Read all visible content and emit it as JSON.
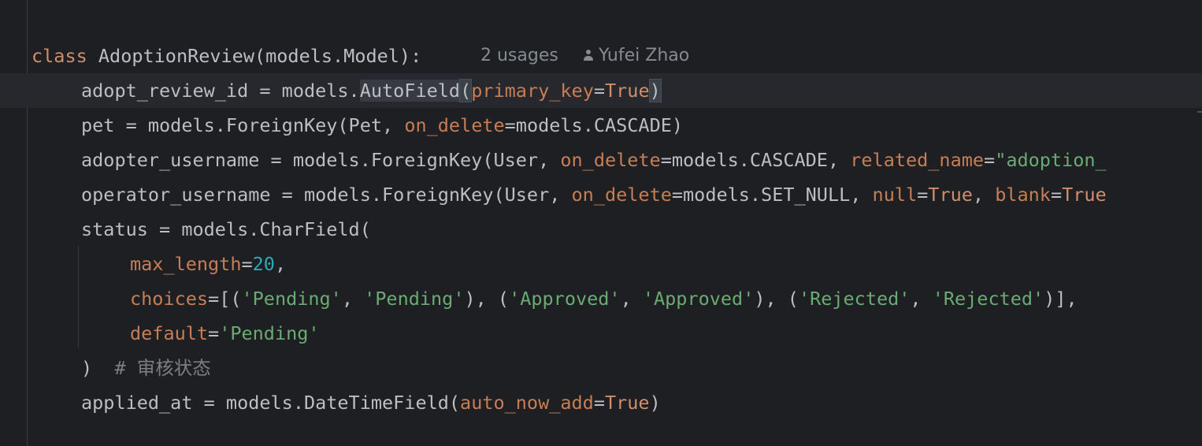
{
  "code": {
    "class_line": {
      "keyword": "class",
      "name": "AdoptionReview",
      "open": "(",
      "base": "models.Model",
      "close": "):",
      "usages": "2 usages",
      "author": "Yufei Zhao"
    },
    "line_id": {
      "a": "adopt_review_id = models.",
      "b": "AutoField",
      "c": "(",
      "d": "primary_key",
      "e": "=",
      "f": "True",
      "g": ")"
    },
    "line_pet": {
      "a": "pet = models.ForeignKey(Pet, ",
      "b": "on_delete",
      "c": "=models.CASCADE)"
    },
    "line_adopter": {
      "a": "adopter_username = models.ForeignKey(User, ",
      "b": "on_delete",
      "c": "=models.CASCADE, ",
      "d": "related_name",
      "e": "=",
      "f": "\"adoption_"
    },
    "line_operator": {
      "a": "operator_username = models.ForeignKey(User, ",
      "b": "on_delete",
      "c": "=models.SET_NULL, ",
      "d": "null",
      "e": "=",
      "f": "True",
      "g": ", ",
      "h": "blank",
      "i": "=",
      "j": "True"
    },
    "line_status": {
      "a": "status = models.CharField("
    },
    "line_maxlen": {
      "a": "max_length",
      "b": "=",
      "c": "20",
      "d": ","
    },
    "line_choices": {
      "a": "choices",
      "b": "=[(",
      "c": "'Pending'",
      "d": ", ",
      "e": "'Pending'",
      "f": "), (",
      "g": "'Approved'",
      "h": ", ",
      "i": "'Approved'",
      "j": "), (",
      "k": "'Rejected'",
      "l": ", ",
      "m": "'Rejected'",
      "n": ")],"
    },
    "line_default": {
      "a": "default",
      "b": "=",
      "c": "'Pending'"
    },
    "line_close": {
      "a": ")",
      "b": "  # 审核状态"
    },
    "line_applied": {
      "a": "applied_at = models.DateTimeField(",
      "b": "auto_now_add",
      "c": "=",
      "d": "True",
      "e": ")"
    }
  },
  "colors": {
    "background": "#1e1f22",
    "keyword": "#cf8e6d",
    "parameter": "#c77d55",
    "string": "#6aab73",
    "number": "#2aacb8",
    "comment": "#7a7e85",
    "text": "#bcbec4",
    "hint": "#868a91"
  },
  "icons": {
    "author": "person-icon"
  }
}
